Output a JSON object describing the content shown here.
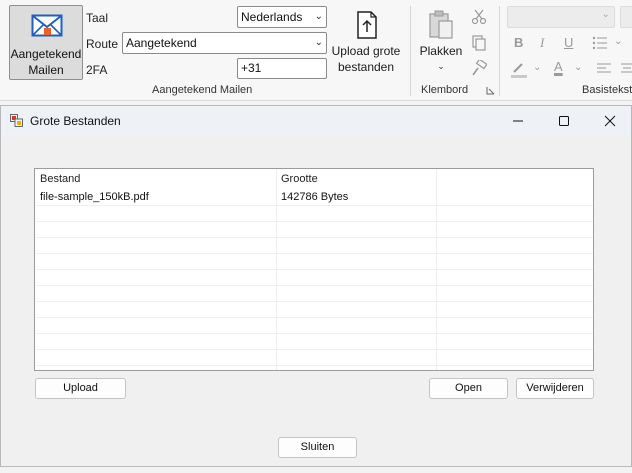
{
  "ribbon": {
    "send_button_line1": "Aangetekend",
    "send_button_line2": "Mailen",
    "taal_label": "Taal",
    "taal_value": "Nederlands",
    "route_label": "Route",
    "route_value": "Aangetekend",
    "twofa_label": "2FA",
    "twofa_value": "+31",
    "group_aangetekend": "Aangetekend Mailen",
    "upload_line1": "Upload grote",
    "upload_line2": "bestanden",
    "paste_label": "Plakken",
    "group_klembord": "Klembord",
    "group_basistekst": "Basistekst"
  },
  "window": {
    "title": "Grote Bestanden",
    "columns": [
      "Bestand",
      "Grootte"
    ],
    "rows": [
      {
        "file": "file-sample_150kB.pdf",
        "size": "142786 Bytes"
      }
    ],
    "upload_button": "Upload",
    "open_button": "Open",
    "delete_button": "Verwijderen",
    "close_button": "Sluiten"
  },
  "colors": {
    "ribbon_bg": "#f7f7f7",
    "window_bg": "#f0f0f0",
    "titlebar_bg": "#eef2f6",
    "envelope_blue": "#1f5fbf",
    "envelope_accent": "#e8632b"
  }
}
